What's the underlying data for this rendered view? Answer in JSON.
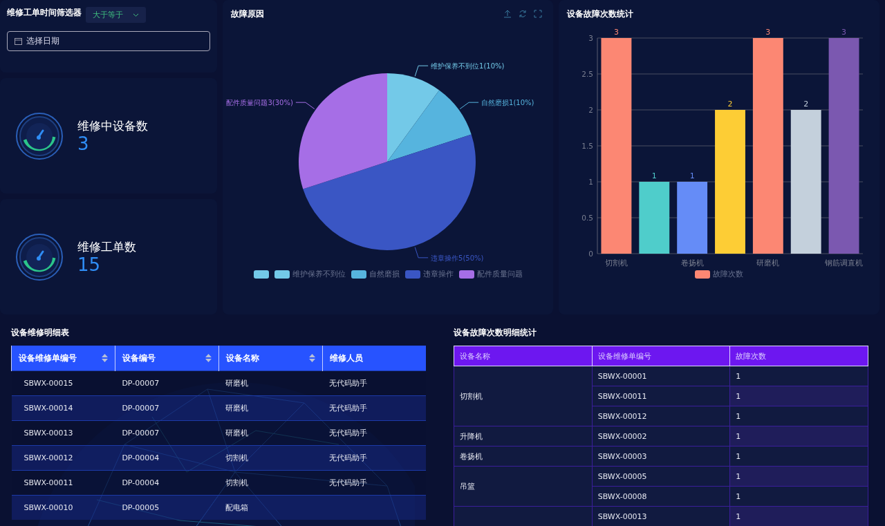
{
  "filter": {
    "title": "维修工单时间筛选器",
    "operator": "大于等于",
    "date_placeholder": "选择日期"
  },
  "stats": [
    {
      "label": "维修中设备数",
      "value": "3"
    },
    {
      "label": "维修工单数",
      "value": "15"
    }
  ],
  "pie_panel": {
    "title": "故障原因",
    "chart_data": {
      "type": "pie",
      "categories": [
        "维护保养不到位",
        "自然磨损",
        "违章操作",
        "配件质量问题"
      ],
      "series": [
        {
          "values": [
            10,
            10,
            50,
            30
          ]
        }
      ],
      "value_labels": [
        "维护保养不到位1(10%)",
        "自然磨损1(10%)",
        "违章操作5(50%)",
        "配件质量问题3(30%)"
      ]
    },
    "legend_swatches": [
      {
        "color": "#73c9e8"
      },
      {
        "color": "#73c9e8"
      },
      {
        "color": "#56b4de"
      },
      {
        "color": "#3a56c4"
      },
      {
        "color": "#a66ee6"
      }
    ]
  },
  "bar_panel": {
    "title": "设备故障次数统计",
    "chart_data": {
      "type": "bar",
      "categories": [
        "切割机",
        null,
        "卷扬机",
        null,
        "研磨机",
        null,
        "钢筋调直机"
      ],
      "ylim": [
        0,
        3
      ],
      "yticks": [
        {
          "value": 0,
          "label": "0"
        },
        {
          "value": 0.5,
          "label": "0.5"
        },
        {
          "value": 1,
          "label": "1"
        },
        {
          "value": 1.5,
          "label": "1.5"
        },
        {
          "value": 2,
          "label": "2"
        },
        {
          "value": 2.5,
          "label": "2.5"
        },
        {
          "value": 3,
          "label": "3"
        }
      ],
      "data_labels": true,
      "grid": true,
      "series": [
        {
          "name": "故障次数",
          "values": [
            3,
            1,
            1,
            2,
            3,
            2,
            3
          ]
        }
      ]
    },
    "bars": [
      {
        "color": "#fc8773"
      },
      {
        "color": "#4fcdcb"
      },
      {
        "color": "#658cf7"
      },
      {
        "color": "#fdcd35"
      },
      {
        "color": "#fc8773"
      },
      {
        "color": "#c4d0dc"
      },
      {
        "color": "#7b58b0"
      }
    ]
  },
  "repair_table": {
    "title": "设备维修明细表",
    "columns": [
      {
        "label": "设备维修单编号",
        "sortable": true
      },
      {
        "label": "设备编号",
        "sortable": true
      },
      {
        "label": "设备名称",
        "sortable": true
      },
      {
        "label": "维修人员",
        "sortable": false
      }
    ],
    "rows": [
      [
        "SBWX-00015",
        "DP-00007",
        "研磨机",
        "无代码助手"
      ],
      [
        "SBWX-00014",
        "DP-00007",
        "研磨机",
        "无代码助手"
      ],
      [
        "SBWX-00013",
        "DP-00007",
        "研磨机",
        "无代码助手"
      ],
      [
        "SBWX-00012",
        "DP-00004",
        "切割机",
        "无代码助手"
      ],
      [
        "SBWX-00011",
        "DP-00004",
        "切割机",
        "无代码助手"
      ],
      [
        "SBWX-00010",
        "DP-00005",
        "配电箱"
      ]
    ]
  },
  "fault_table": {
    "title": "设备故障次数明细统计",
    "columns": [
      "设备名称",
      "设备维修单编号",
      "故障次数"
    ],
    "groups": [
      {
        "name": "切割机",
        "rows": [
          [
            "SBWX-00001",
            "1"
          ],
          [
            "SBWX-00011",
            "1"
          ],
          [
            "SBWX-00012",
            "1"
          ]
        ]
      },
      {
        "name": "升降机",
        "rows": [
          [
            "SBWX-00002",
            "1"
          ]
        ]
      },
      {
        "name": "卷扬机",
        "rows": [
          [
            "SBWX-00003",
            "1"
          ]
        ]
      },
      {
        "name": "吊篮",
        "rows": [
          [
            "SBWX-00005",
            "1"
          ],
          [
            "SBWX-00008",
            "1"
          ]
        ]
      },
      {
        "rows": [
          [
            "SBWX-00013",
            "1"
          ]
        ]
      }
    ]
  }
}
